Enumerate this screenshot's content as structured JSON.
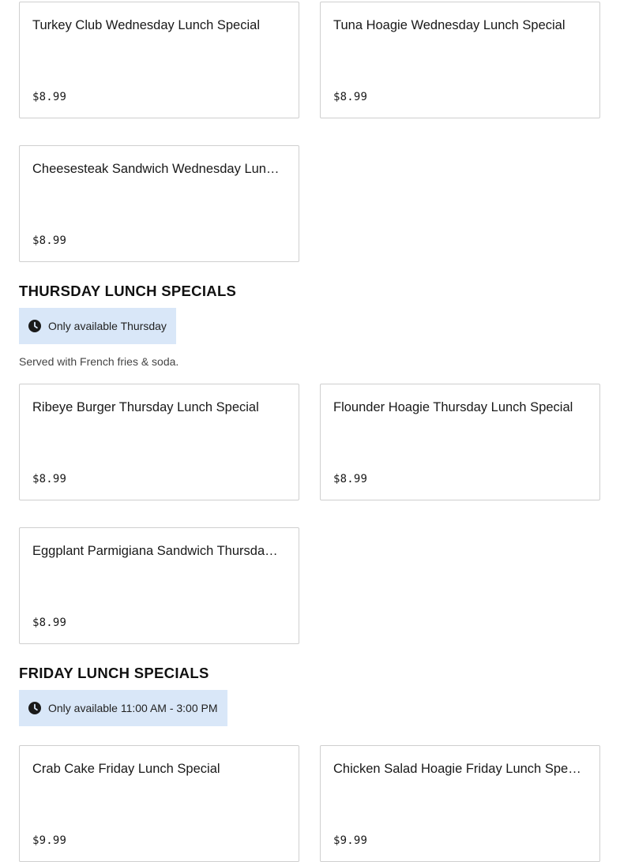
{
  "wednesday": {
    "items": [
      {
        "name": "Turkey Club Wednesday Lunch Special",
        "price": "$8.99"
      },
      {
        "name": "Tuna Hoagie Wednesday Lunch Special",
        "price": "$8.99"
      },
      {
        "name": "Cheesesteak Sandwich Wednesday Lunch Special",
        "price": "$8.99"
      }
    ]
  },
  "thursday": {
    "title": "THURSDAY LUNCH SPECIALS",
    "availability": "Only available Thursday",
    "availability_icon": "clock-icon",
    "description": "Served with French fries & soda.",
    "items": [
      {
        "name": "Ribeye Burger Thursday Lunch Special",
        "price": "$8.99"
      },
      {
        "name": "Flounder Hoagie Thursday Lunch Special",
        "price": "$8.99"
      },
      {
        "name": "Eggplant Parmigiana Sandwich Thursday Lunch Special",
        "price": "$8.99"
      }
    ]
  },
  "friday": {
    "title": "FRIDAY LUNCH SPECIALS",
    "availability": "Only available 11:00 AM - 3:00 PM",
    "availability_icon": "clock-icon",
    "items": [
      {
        "name": "Crab Cake Friday Lunch Special",
        "price": "$9.99"
      },
      {
        "name": "Chicken Salad Hoagie Friday Lunch Special",
        "price": "$9.99"
      }
    ]
  },
  "colors": {
    "availability_bg": "#d9e7f8",
    "card_border": "#cfcfcf",
    "text": "#191919"
  }
}
